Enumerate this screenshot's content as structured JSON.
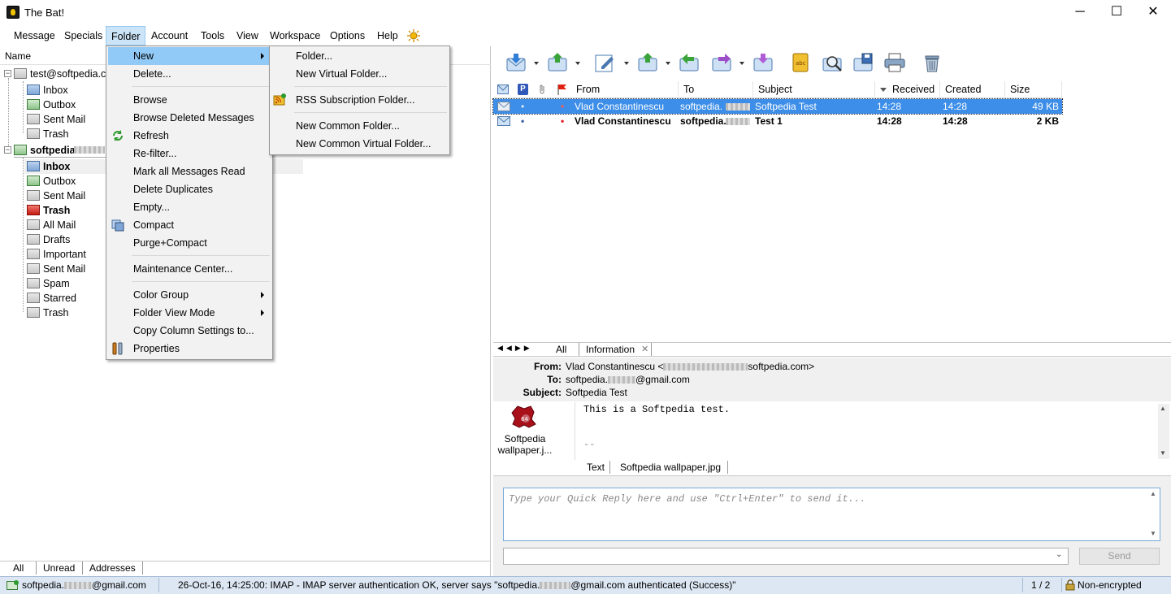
{
  "window": {
    "title": "The Bat!",
    "minimize": "─",
    "maximize": "☐",
    "close": "✕"
  },
  "menubar": [
    "Message",
    "Specials",
    "Folder",
    "Account",
    "Tools",
    "View",
    "Workspace",
    "Options",
    "Help"
  ],
  "folder_menu": {
    "items": [
      "New",
      "Delete...",
      "Browse",
      "Browse Deleted Messages",
      "Refresh",
      "Re-filter...",
      "Mark all Messages Read",
      "Delete Duplicates",
      "Empty...",
      "Compact",
      "Purge+Compact",
      "Maintenance Center...",
      "Color Group",
      "Folder View Mode",
      "Copy Column Settings to...",
      "Properties"
    ]
  },
  "new_submenu": {
    "items": [
      "Folder...",
      "New Virtual Folder...",
      "RSS Subscription Folder...",
      "New Common Folder...",
      "New Common Virtual Folder..."
    ]
  },
  "folder_tree": {
    "header": "Name",
    "account1": {
      "name": "test@softpedia.co",
      "folders": [
        "Inbox",
        "Outbox",
        "Sent Mail",
        "Trash"
      ]
    },
    "account2": {
      "name": "softpedia",
      "folders": [
        "Inbox",
        "Outbox",
        "Sent Mail",
        "Trash",
        "All Mail",
        "Drafts",
        "Important",
        "Sent Mail",
        "Spam",
        "Starred",
        "Trash"
      ]
    },
    "tabs": [
      "All",
      "Unread",
      "Addresses"
    ]
  },
  "message_list": {
    "columns": [
      "From",
      "To",
      "Subject",
      "Received",
      "Created",
      "Size"
    ],
    "rows": [
      {
        "from": "Vlad Constantinescu",
        "to": "softpedia.",
        "subject": "Softpedia Test",
        "received": "14:28",
        "created": "14:28",
        "size": "49 KB"
      },
      {
        "from": "Vlad Constantinescu",
        "to": "softpedia.",
        "subject": "Test 1",
        "received": "14:28",
        "created": "14:28",
        "size": "2 KB"
      }
    ]
  },
  "preview": {
    "tabs": [
      "All",
      "Information"
    ],
    "from_label": "From:",
    "from_name": "Vlad Constantinescu <",
    "from_domain": "softpedia.com>",
    "to_label": "To:",
    "to_prefix": "softpedia.",
    "to_suffix": "@gmail.com",
    "subject_label": "Subject:",
    "subject": "Softpedia Test",
    "attachment_name": "Softpedia wallpaper.j...",
    "body": "This is a Softpedia test.",
    "sig": "--",
    "attach_tabs": [
      "Text",
      "Softpedia wallpaper.jpg"
    ],
    "quick_reply_placeholder": "Type your Quick Reply here and use \"Ctrl+Enter\" to send it...",
    "send_label": "Send"
  },
  "status": {
    "account_prefix": "softpedia.",
    "account_suffix": "@gmail.com",
    "log_prefix": "26-Oct-16, 14:25:00: IMAP  - IMAP server authentication OK, server says \"softpedia.",
    "log_suffix": "@gmail.com authenticated (Success)\"",
    "count": "1 / 2",
    "encryption": "Non-encrypted"
  },
  "colors": {
    "menu_highlight": "#91c9f7",
    "selection": "#3d8ee8",
    "status_bg": "#dde7f3"
  }
}
